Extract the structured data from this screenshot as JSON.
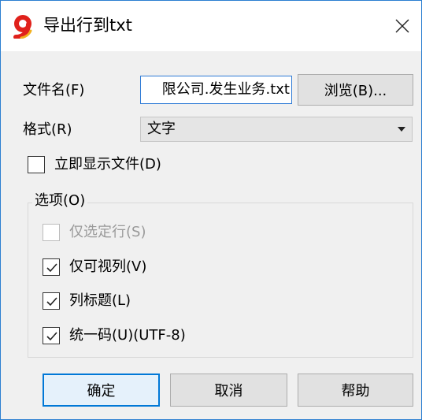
{
  "window": {
    "title": "导出行到txt",
    "close_symbol": "✕"
  },
  "file": {
    "label": "文件名(F)",
    "value": "限公司.发生业务.txt",
    "browse_label": "浏览(B)..."
  },
  "format": {
    "label": "格式(R)",
    "selected": "文字"
  },
  "open_after": {
    "label": "立即显示文件(D)",
    "checked": false
  },
  "options": {
    "group_label": "选项(O)",
    "items": [
      {
        "label": "仅选定行(S)",
        "checked": false,
        "enabled": false
      },
      {
        "label": "仅可视列(V)",
        "checked": true,
        "enabled": true
      },
      {
        "label": "列标题(L)",
        "checked": true,
        "enabled": true
      },
      {
        "label": "统一码(U)(UTF-8)",
        "checked": true,
        "enabled": true
      }
    ]
  },
  "buttons": {
    "ok": "确定",
    "cancel": "取消",
    "help": "帮助"
  },
  "colors": {
    "accent": "#0078d7",
    "app_icon_red": "#e0211b",
    "app_icon_gold": "#f2b01e"
  }
}
